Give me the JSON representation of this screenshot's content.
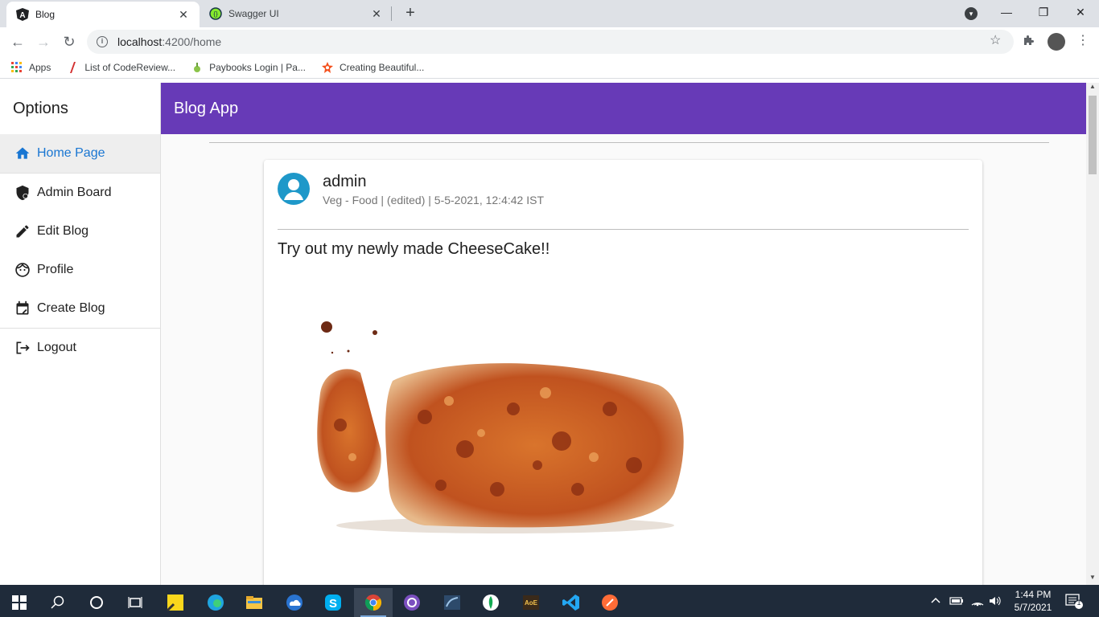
{
  "browser": {
    "tabs": [
      {
        "title": "Blog",
        "close": "✕"
      },
      {
        "title": "Swagger UI",
        "close": "✕"
      }
    ],
    "new_tab": "+",
    "window_controls": {
      "minimize": "—",
      "restore": "❐",
      "close": "✕"
    },
    "url_host": "localhost",
    "url_path": ":4200/home",
    "bookmarks": [
      "Apps",
      "List of CodeReview...",
      "Paybooks Login | Pa...",
      "Creating Beautiful..."
    ]
  },
  "sidenav": {
    "title": "Options",
    "items": [
      {
        "label": "Home Page",
        "icon": "home-icon"
      },
      {
        "label": "Admin Board",
        "icon": "admin-shield-icon"
      },
      {
        "label": "Edit Blog",
        "icon": "pencil-icon"
      },
      {
        "label": "Profile",
        "icon": "face-icon"
      },
      {
        "label": "Create Blog",
        "icon": "calendar-edit-icon"
      },
      {
        "label": "Logout",
        "icon": "logout-icon"
      }
    ]
  },
  "header": {
    "title": "Blog App"
  },
  "post": {
    "author": "admin",
    "meta": "Veg - Food | (edited) | 5-5-2021, 12:4:42 IST",
    "title": "Try out my newly made CheeseCake!!"
  },
  "taskbar": {
    "time": "1:44 PM",
    "date": "5/7/2021",
    "notifications": "1"
  },
  "colors": {
    "toolbar_purple": "#673ab7",
    "active_blue": "#1976d2",
    "avatar_blue": "#1e98c9"
  }
}
